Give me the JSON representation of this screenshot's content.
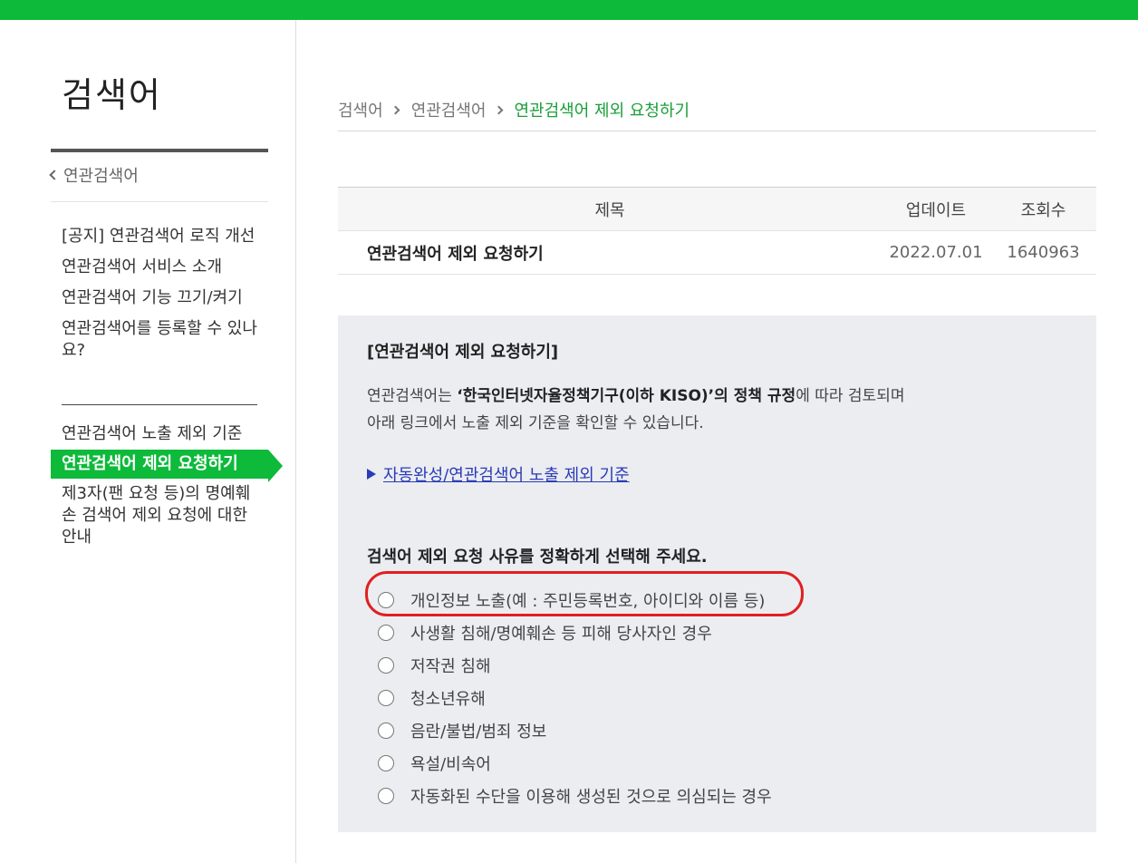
{
  "colors": {
    "accent": "#0dba3a",
    "highlight": "#e02020"
  },
  "sidebar": {
    "title": "검색어",
    "back_label": "연관검색어",
    "group_a": [
      "[공지] 연관검색어 로직 개선",
      "연관검색어 서비스 소개",
      "연관검색어 기능 끄기/켜기",
      "연관검색어를 등록할 수 있나요?"
    ],
    "group_b": [
      "연관검색어 노출 제외 기준",
      "연관검색어 제외 요청하기",
      "제3자(팬 요청 등)의 명예훼손 검색어 제외 요청에 대한 안내"
    ]
  },
  "breadcrumb": [
    "검색어",
    "연관검색어",
    "연관검색어 제외 요청하기"
  ],
  "board": {
    "headers": {
      "title": "제목",
      "date": "업데이트",
      "views": "조회수"
    },
    "row": {
      "title": "연관검색어 제외 요청하기",
      "date": "2022.07.01",
      "views": "1640963"
    }
  },
  "content": {
    "heading": "[연관검색어 제외 요청하기]",
    "desc_pre": "연관검색어는 ",
    "desc_bold": "‘한국인터넷자율정책기구(이하 KISO)’의 정책 규정",
    "desc_post": "에 따라 검토되며",
    "desc_line2": "아래 링크에서 노출 제외 기준을 확인할 수 있습니다.",
    "link_text": "자동완성/연관검색어 노출 제외 기준",
    "question": "검색어 제외 요청 사유를 정확하게 선택해 주세요.",
    "options": [
      "개인정보 노출(예 : 주민등록번호, 아이디와 이름 등)",
      "사생활 침해/명예훼손 등 피해 당사자인 경우",
      "저작권 침해",
      "청소년유해",
      "음란/불법/범죄 정보",
      "욕설/비속어",
      "자동화된 수단을 이용해 생성된 것으로 의심되는 경우"
    ]
  }
}
